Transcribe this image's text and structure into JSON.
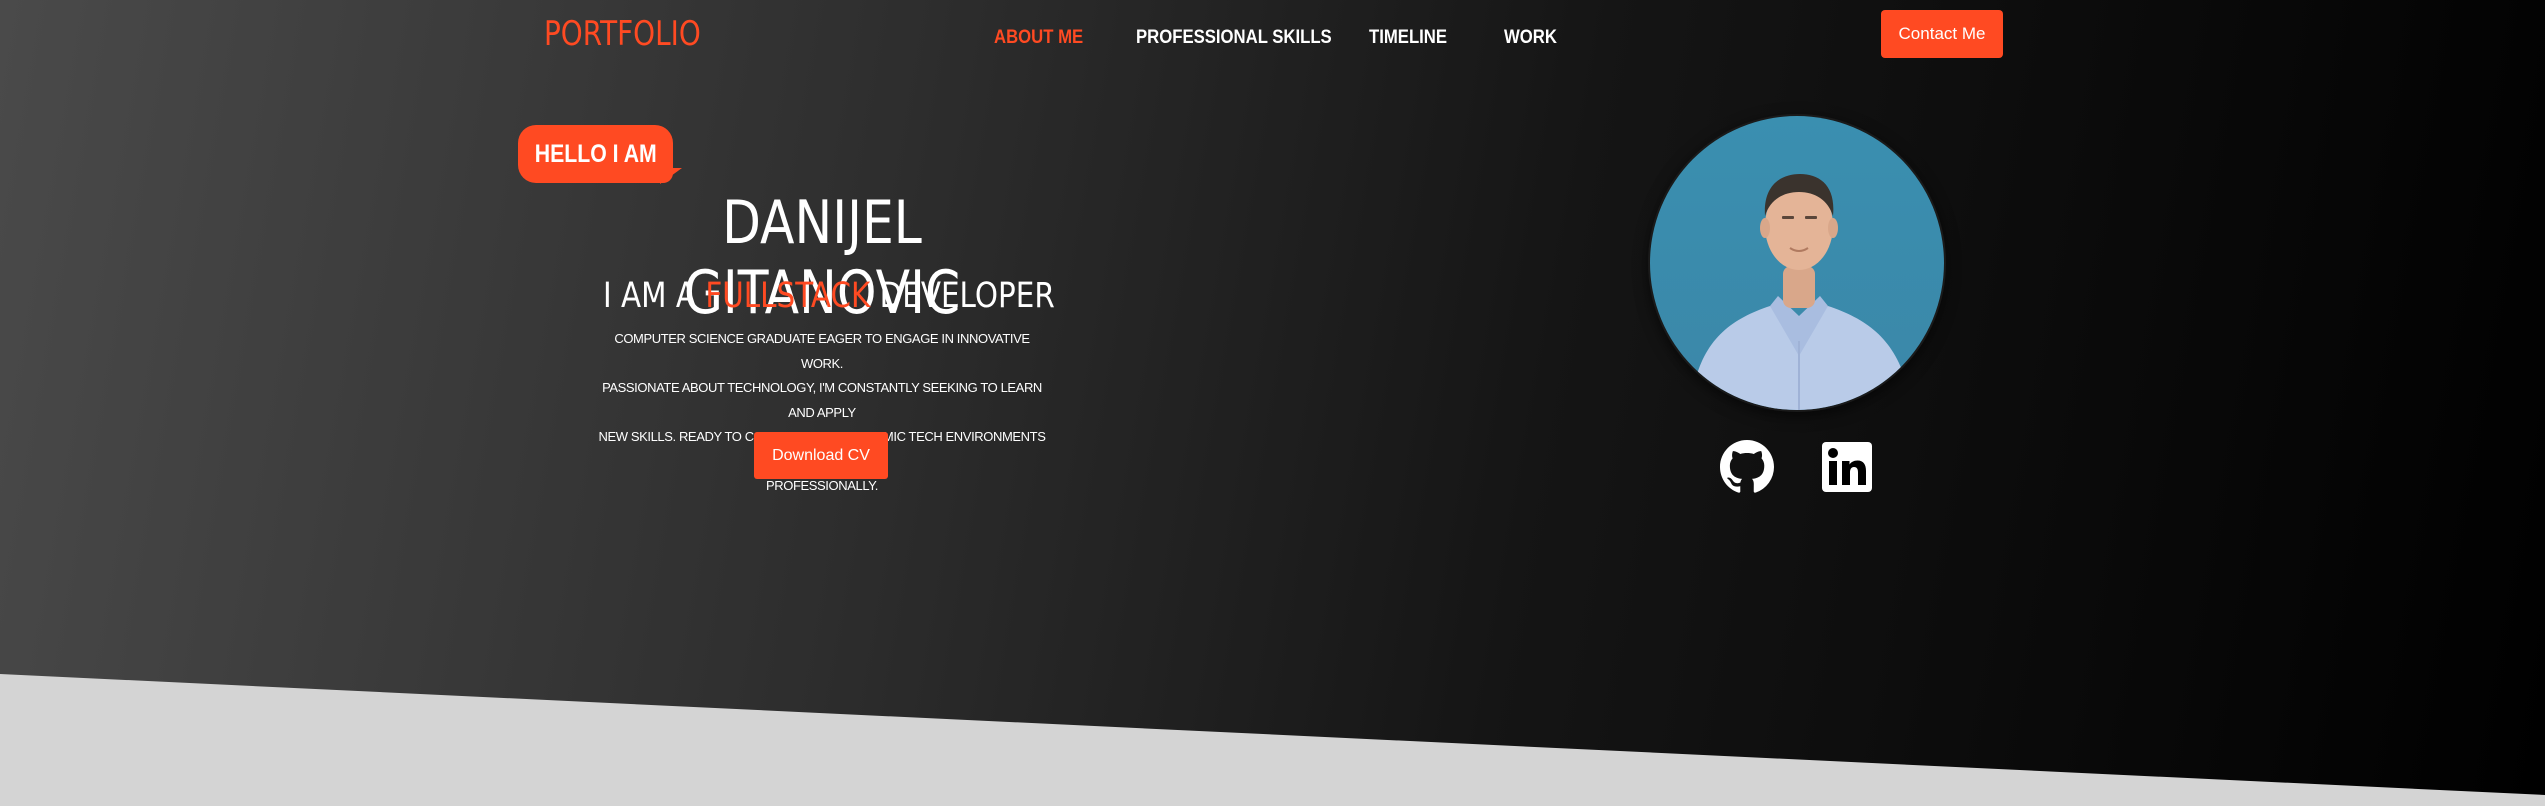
{
  "header": {
    "logo": "PORTFOLIO",
    "nav": [
      {
        "label": "ABOUT ME",
        "active": true
      },
      {
        "label": "PROFESSIONAL SKILLS",
        "active": false
      },
      {
        "label": "TIMELINE",
        "active": false
      },
      {
        "label": "WORK",
        "active": false
      }
    ],
    "contact_label": "Contact Me"
  },
  "hero": {
    "greeting": "HELLO I AM",
    "name": "DANIJEL GITANOVIC",
    "role_prefix": "I AM A",
    "role_highlight": "FULLSTACK",
    "role_suffix": "DEVELOPER",
    "description_lines": [
      "COMPUTER SCIENCE GRADUATE EAGER TO ENGAGE IN INNOVATIVE WORK.",
      "PASSIONATE ABOUT TECHNOLOGY, I'M CONSTANTLY SEEKING TO LEARN AND APPLY",
      "NEW SKILLS. READY TO CONTRIBUTE TO DYNAMIC TECH ENVIRONMENTS AND GROW",
      "PROFESSIONALLY."
    ],
    "cv_label": "Download CV"
  },
  "profile": {
    "photo_icon": "profile-photo",
    "social": [
      {
        "icon": "github-icon"
      },
      {
        "icon": "linkedin-icon"
      }
    ]
  },
  "colors": {
    "accent": "#ff4a22",
    "text": "#ffffff",
    "footer_band": "#d4d4d4"
  }
}
